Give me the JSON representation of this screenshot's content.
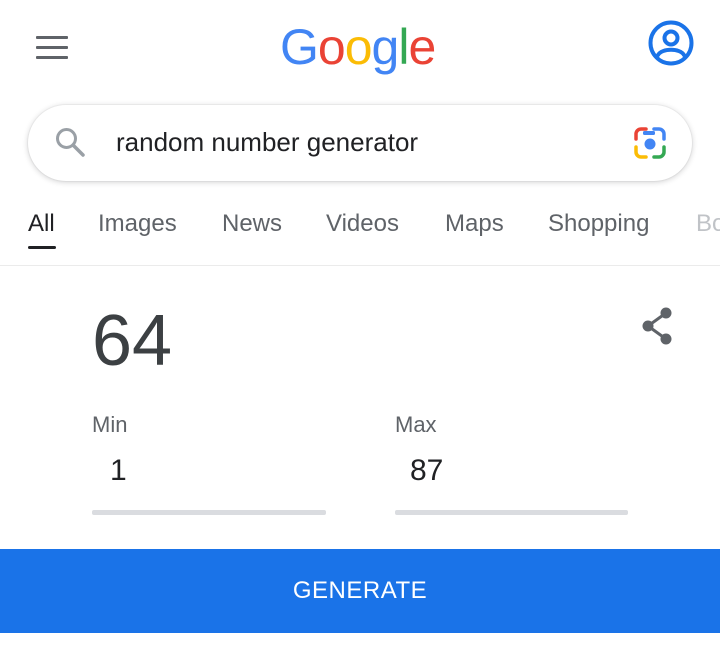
{
  "header": {
    "logo_letters": [
      {
        "char": "G",
        "color": "#4285F4"
      },
      {
        "char": "o",
        "color": "#EA4335"
      },
      {
        "char": "o",
        "color": "#FBBC05"
      },
      {
        "char": "g",
        "color": "#4285F4"
      },
      {
        "char": "l",
        "color": "#34A853"
      },
      {
        "char": "e",
        "color": "#EA4335"
      }
    ],
    "menu_icon": "hamburger-menu-icon",
    "account_icon": "account-circle-icon",
    "account_color": "#1a73e8"
  },
  "search": {
    "query": "random number generator",
    "search_icon": "search-icon",
    "lens_icon": "google-lens-camera-icon"
  },
  "tabs": [
    {
      "label": "All",
      "active": true
    },
    {
      "label": "Images",
      "active": false
    },
    {
      "label": "News",
      "active": false
    },
    {
      "label": "Videos",
      "active": false
    },
    {
      "label": "Maps",
      "active": false
    },
    {
      "label": "Shopping",
      "active": false
    },
    {
      "label": "Bo",
      "active": false
    }
  ],
  "rng": {
    "result": "64",
    "share_icon": "share-icon",
    "min_label": "Min",
    "min_value": "1",
    "max_label": "Max",
    "max_value": "87",
    "generate_label": "GENERATE",
    "accent_color": "#1a73e8"
  }
}
